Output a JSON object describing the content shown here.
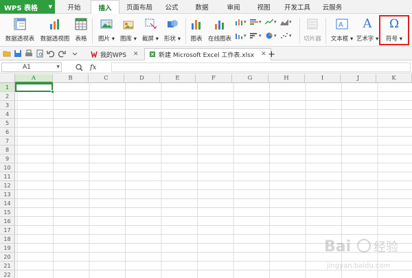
{
  "app": {
    "label": "WPS 表格"
  },
  "menu": {
    "tabs": [
      {
        "label": "开始",
        "active": false
      },
      {
        "label": "插入",
        "active": true
      },
      {
        "label": "页面布局",
        "active": false
      },
      {
        "label": "公式",
        "active": false
      },
      {
        "label": "数据",
        "active": false
      },
      {
        "label": "审阅",
        "active": false
      },
      {
        "label": "视图",
        "active": false
      },
      {
        "label": "开发工具",
        "active": false
      },
      {
        "label": "云服务",
        "active": false
      }
    ]
  },
  "ribbon": {
    "pivot_table": "数据透视表",
    "pivot_chart": "数据透视图",
    "table": "表格",
    "picture": "图片",
    "gallery": "图库",
    "screenshot": "截屏",
    "shapes": "形状",
    "chart": "图表",
    "online_chart": "在线图表",
    "slicer": "切片器",
    "textbox": "文本框",
    "wordart": "艺术字",
    "symbol": "符号",
    "symbol_glyph": "Ω",
    "wordart_glyph": "A",
    "highlight_color": "#e02020"
  },
  "doc_tabs": {
    "mywps": "我的WPS",
    "workbook": "新建 Microsoft Excel 工作表.xlsx",
    "add": "+"
  },
  "formula_bar": {
    "name_box": "A1",
    "fx": "fx"
  },
  "sheet": {
    "columns": [
      "A",
      "B",
      "C",
      "D",
      "E",
      "F",
      "G",
      "H",
      "I",
      "J",
      "K"
    ],
    "rows": [
      "1",
      "2",
      "3",
      "4",
      "5",
      "6",
      "7",
      "8",
      "9",
      "10",
      "11",
      "12",
      "13",
      "14",
      "15",
      "16",
      "17",
      "18",
      "19",
      "20",
      "21",
      "22"
    ],
    "selected_cell": "A1"
  },
  "watermark": {
    "line1": "Bai 经验",
    "line2": "jingyan.baidu.com"
  }
}
